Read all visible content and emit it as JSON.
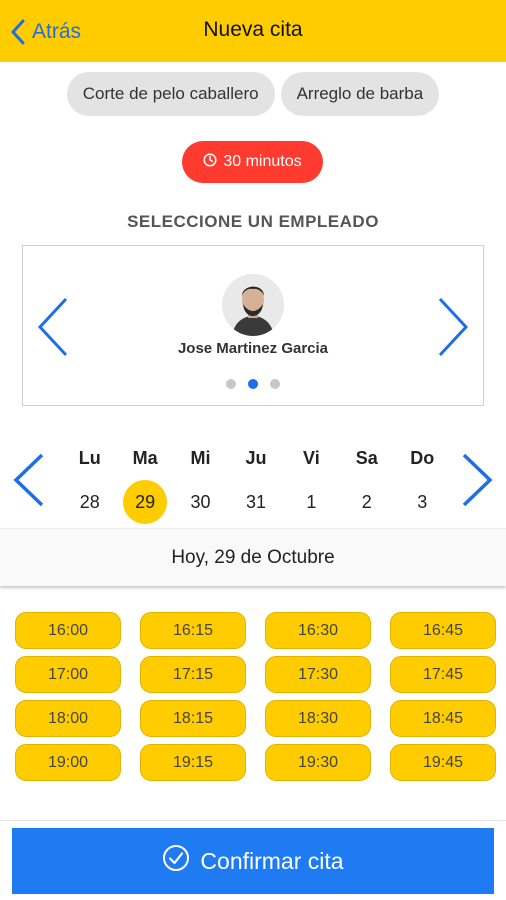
{
  "header": {
    "back_label": "Atrás",
    "title": "Nueva cita"
  },
  "services": [
    {
      "label": "Corte de pelo caballero"
    },
    {
      "label": "Arreglo de barba"
    }
  ],
  "duration": {
    "label": "30 minutos",
    "color": "#FF3B30"
  },
  "employee_section": {
    "title": "SELECCIONE UN EMPLEADO",
    "employee_name": "Jose Martinez Garcia",
    "carousel_dots": 3,
    "active_dot": 1
  },
  "week": {
    "days": [
      {
        "name": "Lu",
        "num": "28"
      },
      {
        "name": "Ma",
        "num": "29",
        "selected": true
      },
      {
        "name": "Mi",
        "num": "30"
      },
      {
        "name": "Ju",
        "num": "31"
      },
      {
        "name": "Vi",
        "num": "1"
      },
      {
        "name": "Sa",
        "num": "2"
      },
      {
        "name": "Do",
        "num": "3"
      }
    ]
  },
  "selected_date_label": "Hoy, 29 de Octubre",
  "time_slots": [
    "16:00",
    "16:15",
    "16:30",
    "16:45",
    "17:00",
    "17:15",
    "17:30",
    "17:45",
    "18:00",
    "18:15",
    "18:30",
    "18:45",
    "19:00",
    "19:15",
    "19:30",
    "19:45"
  ],
  "confirm": {
    "label": "Confirmar cita",
    "icon": "check-circle-icon"
  },
  "colors": {
    "accent_yellow": "#FFCC00",
    "accent_blue": "#1E6FE6",
    "confirm_blue": "#1E7BF2"
  }
}
